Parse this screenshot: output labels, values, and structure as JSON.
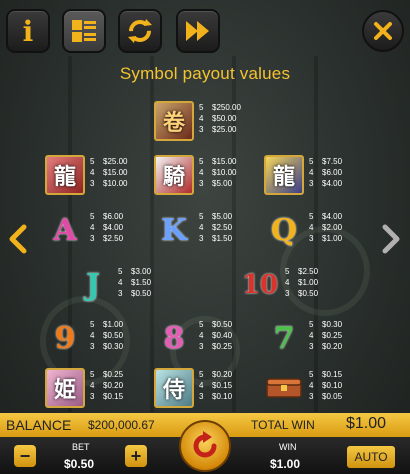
{
  "toolbar": {
    "info_icon": "info-icon",
    "paytable_icon": "paytable-list-icon",
    "autoplay_icon": "refresh-icon",
    "turbo_icon": "fast-forward-icon",
    "close_icon": "close-icon",
    "accent_color": "#f2b21c"
  },
  "panel": {
    "title": "Symbol payout values"
  },
  "paytable": {
    "multipliers": [
      "5",
      "4",
      "3"
    ],
    "symbols": [
      {
        "id": "wild-scroll",
        "icon": "scroll-icon",
        "values": [
          "$250.00",
          "$50.00",
          "$25.00"
        ]
      },
      {
        "id": "red-dragon",
        "icon": "red-dragon-icon",
        "values": [
          "$25.00",
          "$15.00",
          "$10.00"
        ]
      },
      {
        "id": "red-knight",
        "icon": "red-knight-icon",
        "values": [
          "$15.00",
          "$10.00",
          "$5.00"
        ]
      },
      {
        "id": "gold-dragon",
        "icon": "gold-dragon-icon",
        "values": [
          "$7.50",
          "$6.00",
          "$4.00"
        ]
      },
      {
        "id": "letter-a",
        "icon": "letter-a-icon",
        "glyph": "A",
        "values": [
          "$6.00",
          "$4.00",
          "$2.50"
        ]
      },
      {
        "id": "letter-k",
        "icon": "letter-k-icon",
        "glyph": "K",
        "values": [
          "$5.00",
          "$2.50",
          "$1.50"
        ]
      },
      {
        "id": "letter-q",
        "icon": "letter-q-icon",
        "glyph": "Q",
        "values": [
          "$4.00",
          "$2.00",
          "$1.00"
        ]
      },
      {
        "id": "letter-j",
        "icon": "letter-j-icon",
        "glyph": "J",
        "values": [
          "$3.00",
          "$1.50",
          "$0.50"
        ]
      },
      {
        "id": "number-10",
        "icon": "number-10-icon",
        "glyph": "10",
        "values": [
          "$2.50",
          "$1.00",
          "$0.50"
        ]
      },
      {
        "id": "number-9",
        "icon": "number-9-icon",
        "glyph": "9",
        "values": [
          "$1.00",
          "$0.50",
          "$0.30"
        ]
      },
      {
        "id": "number-8",
        "icon": "number-8-icon",
        "glyph": "8",
        "values": [
          "$0.50",
          "$0.40",
          "$0.25"
        ]
      },
      {
        "id": "number-7",
        "icon": "number-7-icon",
        "glyph": "7",
        "values": [
          "$0.30",
          "$0.25",
          "$0.20"
        ]
      },
      {
        "id": "pink-heroine",
        "icon": "pink-heroine-icon",
        "values": [
          "$0.25",
          "$0.20",
          "$0.15"
        ]
      },
      {
        "id": "white-hero",
        "icon": "white-hero-icon",
        "values": [
          "$0.20",
          "$0.15",
          "$0.10"
        ]
      },
      {
        "id": "treasure-chest",
        "icon": "treasure-chest-icon",
        "values": [
          "$0.15",
          "$0.10",
          "$0.05"
        ]
      }
    ]
  },
  "nav": {
    "prev_icon": "chevron-left-icon",
    "next_icon": "chevron-right-icon"
  },
  "status": {
    "balance_label": "BALANCE",
    "balance_value": "$200,000.67",
    "total_win_label": "TOTAL WIN",
    "total_win_value": "$1.00"
  },
  "controls": {
    "bet_label": "BET",
    "bet_value": "$0.50",
    "minus_label": "−",
    "plus_label": "+",
    "win_label": "WIN",
    "win_value": "$1.00",
    "auto_label": "AUTO",
    "spin_icon": "spin-icon"
  }
}
